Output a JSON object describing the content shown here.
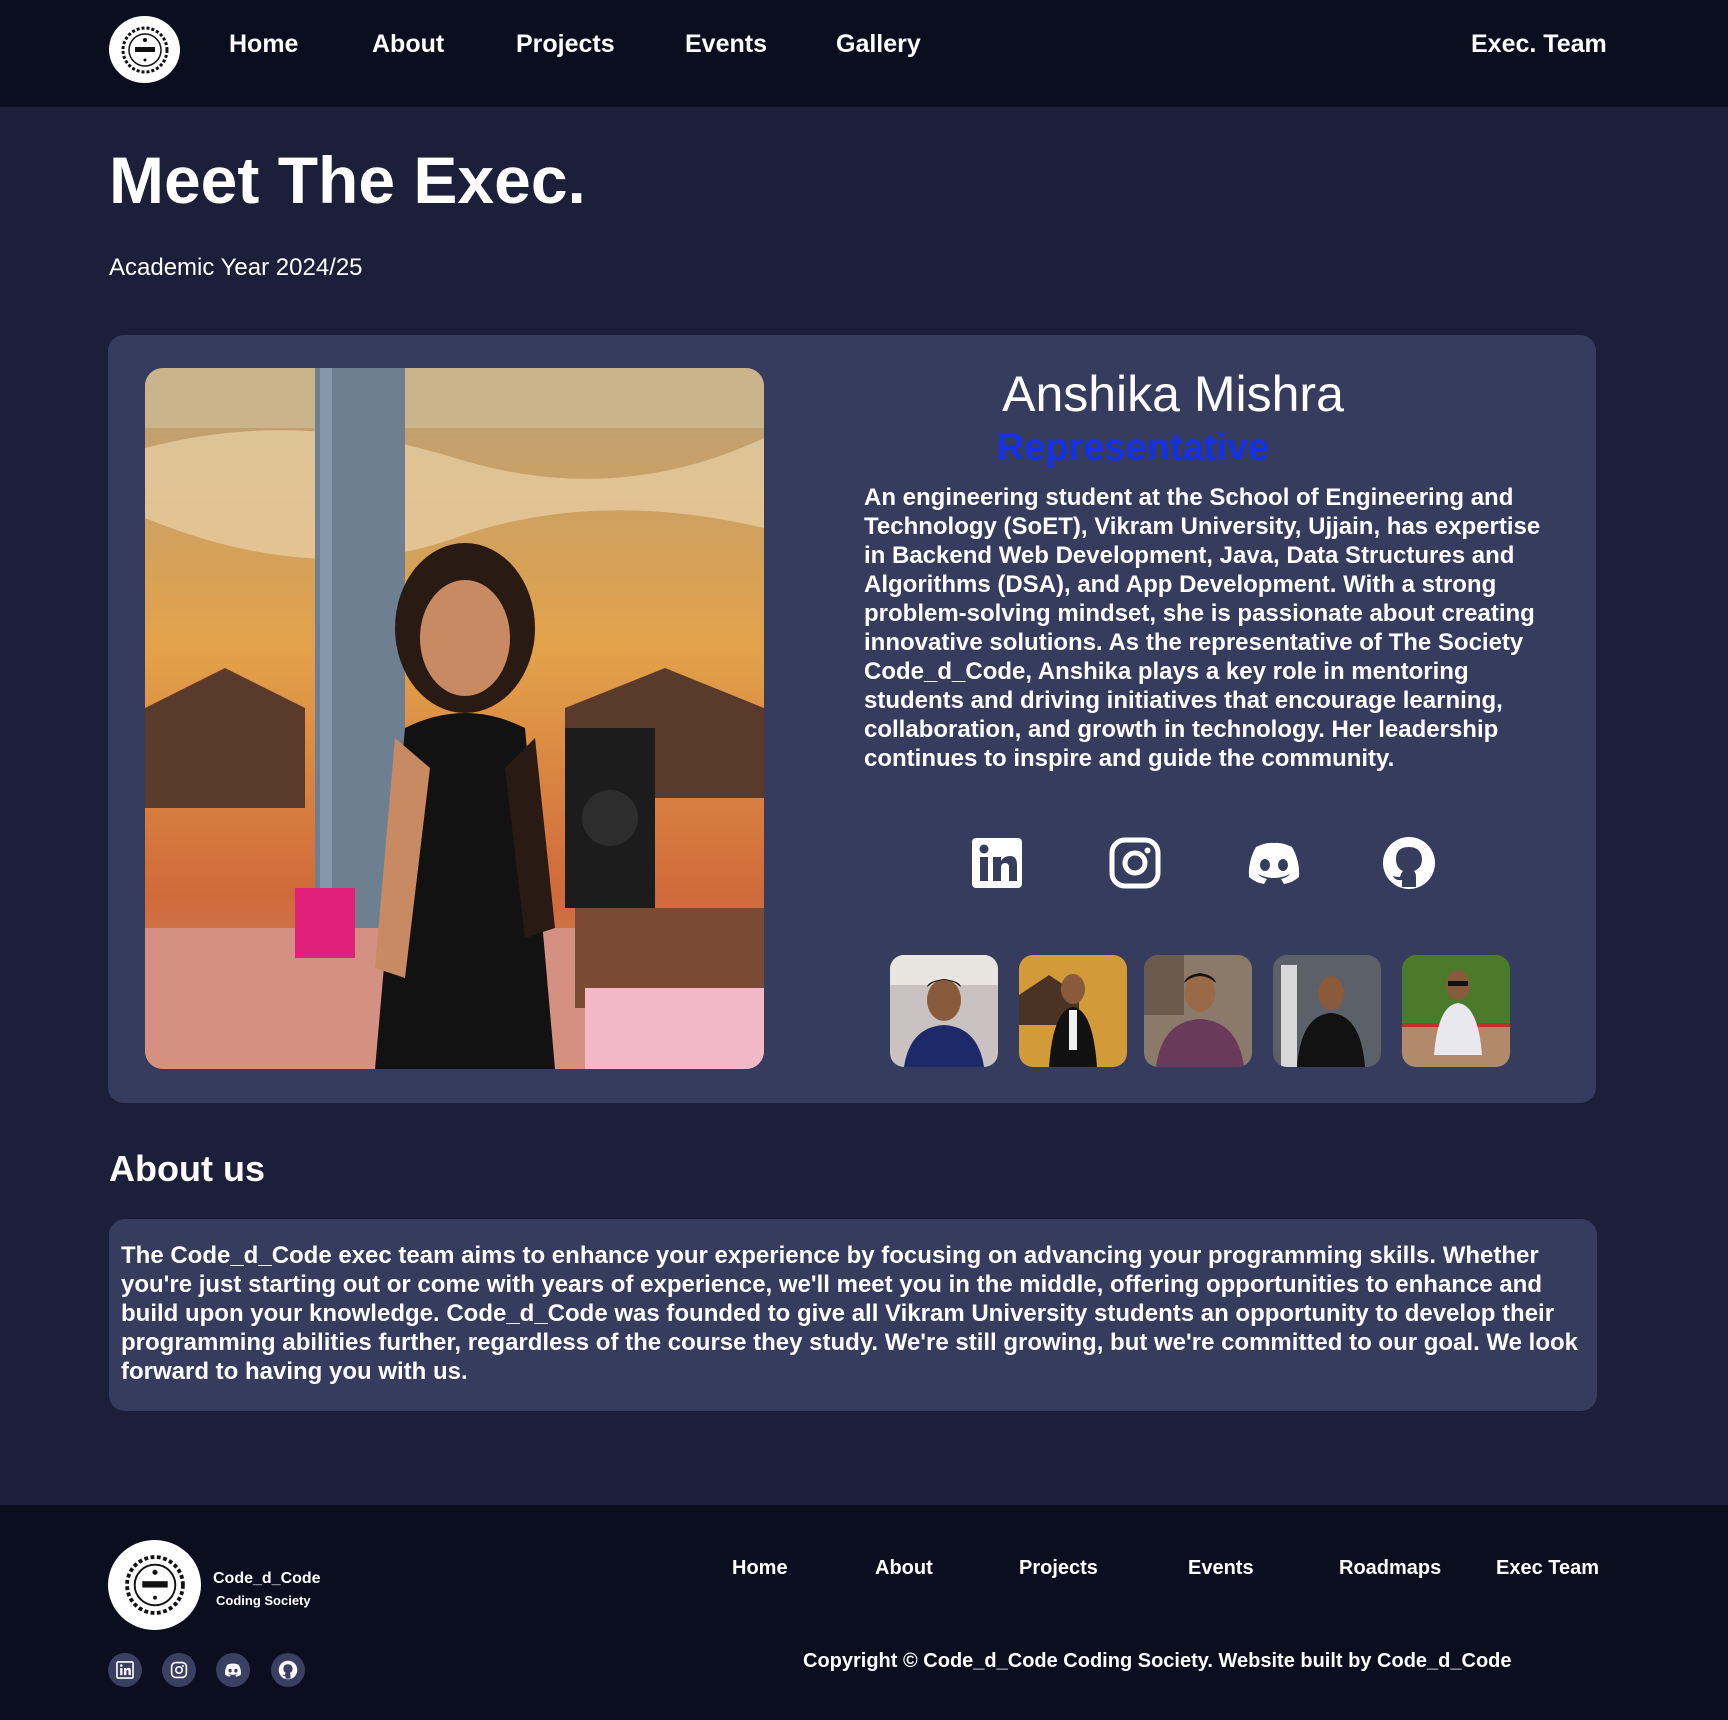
{
  "nav": {
    "links": [
      "Home",
      "About",
      "Projects",
      "Events",
      "Gallery"
    ],
    "exec_team": "Exec. Team",
    "logo_icon": "code-d-code-logo"
  },
  "hero": {
    "title": "Meet The Exec.",
    "subtitle": "Academic Year 2024/25"
  },
  "exec": {
    "name": "Anshika Mishra",
    "role": "Representative",
    "bio": "An engineering student at the School of Engineering and Technology (SoET), Vikram University, Ujjain, has expertise in Backend Web Development, Java, Data Structures and Algorithms (DSA), and App Development. With a strong problem-solving mindset, she is passionate about creating innovative solutions. As the representative of The Society Code_d_Code, Anshika plays a key role in mentoring students and driving initiatives that encourage learning, collaboration, and growth in technology. Her leadership continues to inspire and guide the community.",
    "social_icons": [
      "linkedin-icon",
      "instagram-icon",
      "discord-icon",
      "github-icon"
    ],
    "role_color": "#1531e6"
  },
  "about": {
    "heading": "About us",
    "text": "The Code_d_Code exec team aims to enhance your experience by focusing on advancing your programming skills. Whether you're just starting out or come with years of experience, we'll meet you in the middle, offering opportunities to enhance and build upon your knowledge. Code_d_Code was founded to give all Vikram University students an opportunity to develop their programming abilities further, regardless of the course they study. We're still growing, but we're committed to our goal. We look forward to having you with us."
  },
  "footer": {
    "brand": "Code_d_Code",
    "tagline": "Coding Society",
    "links": [
      "Home",
      "About",
      "Projects",
      "Events",
      "Roadmaps",
      "Exec Team"
    ],
    "copyright": "Copyright © Code_d_Code  Coding Society. Website built by Code_d_Code"
  },
  "colors": {
    "page_bg": "#1b1f3a",
    "nav_bg": "#0a0e1e",
    "card_bg": "#353c5e"
  }
}
